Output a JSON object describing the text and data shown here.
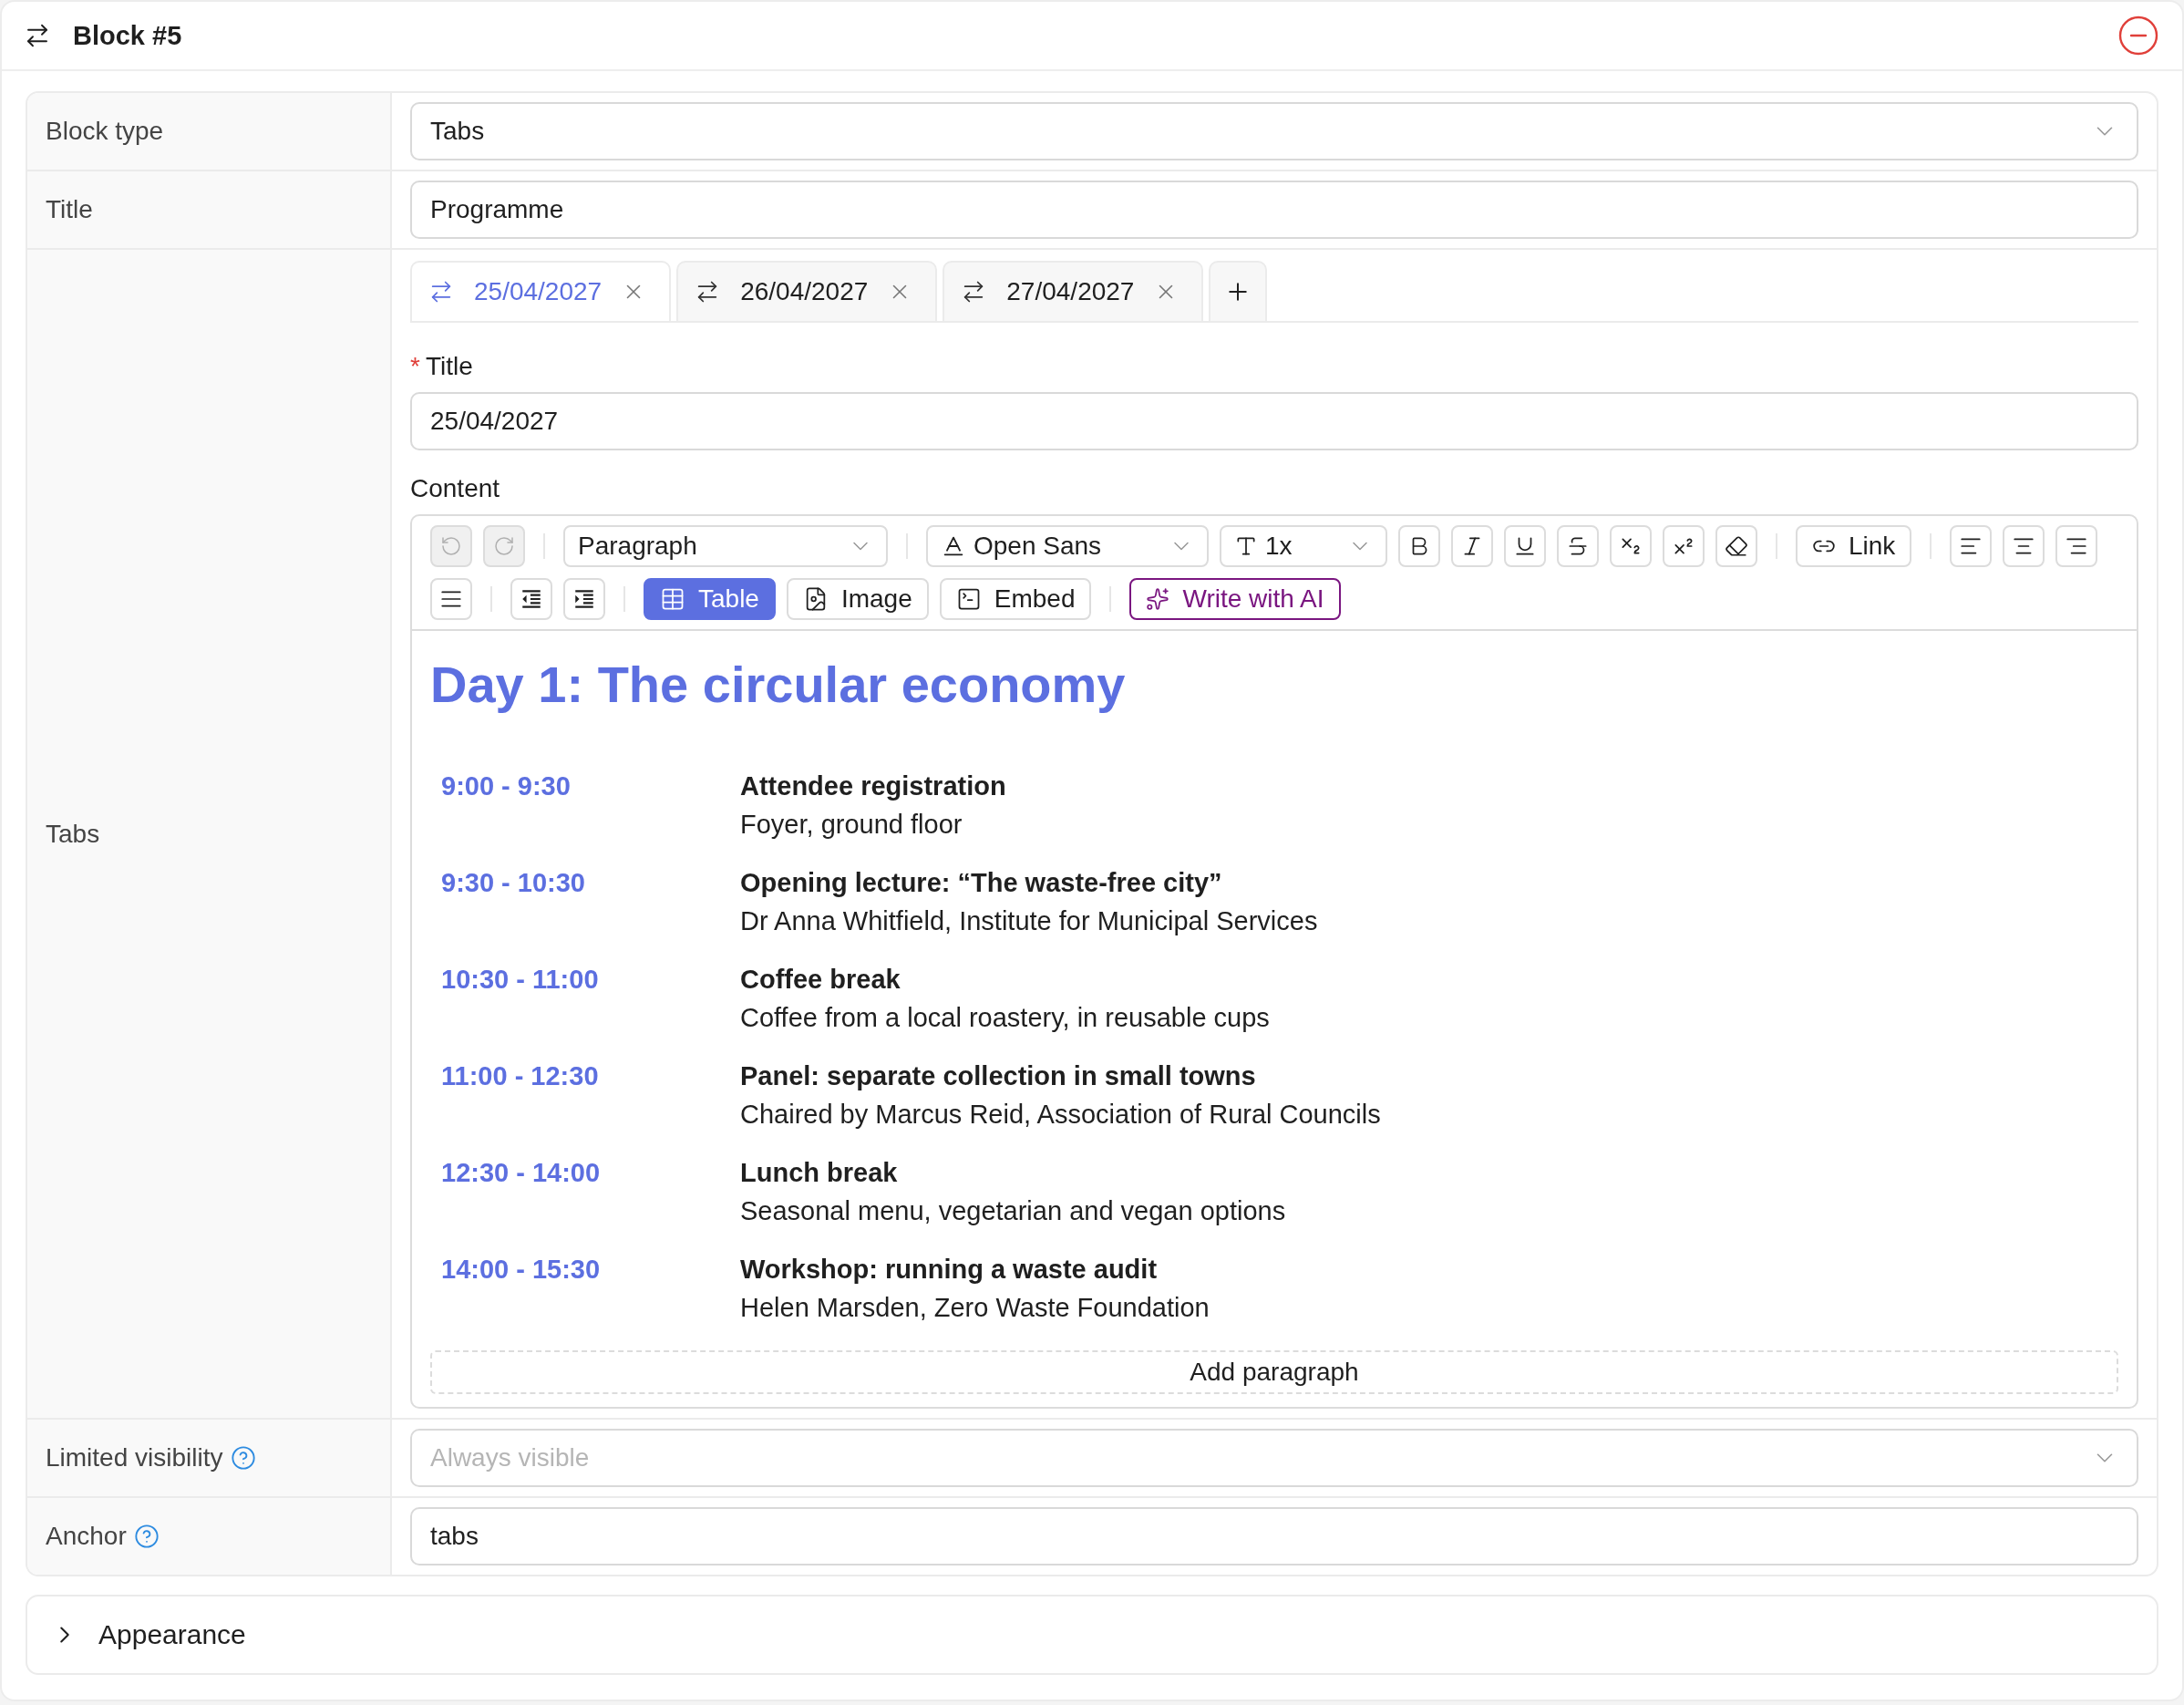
{
  "header": {
    "title": "Block #5"
  },
  "fields": [
    {
      "kind": "select",
      "label": "Block type",
      "value": "Tabs"
    },
    {
      "kind": "text",
      "label": "Title",
      "value": "Programme"
    },
    {
      "kind": "tabs",
      "label": "Tabs"
    },
    {
      "kind": "select",
      "label": "Limited visibility",
      "help": true,
      "placeholder": "Always visible"
    },
    {
      "kind": "text",
      "label": "Anchor",
      "help": true,
      "value": "tabs"
    }
  ],
  "tabs": [
    {
      "label": "25/04/2027",
      "selected": true
    },
    {
      "label": "26/04/2027",
      "selected": false
    },
    {
      "label": "27/04/2027",
      "selected": false
    }
  ],
  "tab_title": {
    "required_mark": "*",
    "label": "Title",
    "value": "25/04/2027"
  },
  "content": {
    "label": "Content",
    "toolbar": {
      "undo": {
        "disabled": true
      },
      "redo": {
        "disabled": true
      },
      "block_style": "Paragraph",
      "font": "Open Sans",
      "size": "1x",
      "link": "Link",
      "inserts": [
        {
          "kind": "table",
          "label": "Table",
          "selected": true
        },
        {
          "kind": "image",
          "label": "Image",
          "selected": false
        },
        {
          "kind": "embed",
          "label": "Embed",
          "selected": false
        }
      ],
      "ai": "Write with AI"
    },
    "heading": "Day 1: The circular economy",
    "schedule": [
      {
        "time": "9:00 - 9:30",
        "title": "Attendee registration",
        "detail": "Foyer, ground floor"
      },
      {
        "time": "9:30 - 10:30",
        "title": "Opening lecture: “The waste-free city”",
        "detail": "Dr Anna Whitfield, Institute for Municipal Services"
      },
      {
        "time": "10:30 - 11:00",
        "title": "Coffee break",
        "detail": "Coffee from a local roastery, in reusable cups"
      },
      {
        "time": "11:00 - 12:30",
        "title": "Panel: separate collection in small towns",
        "detail": "Chaired by Marcus Reid, Association of Rural Councils"
      },
      {
        "time": "12:30 - 14:00",
        "title": "Lunch break",
        "detail": "Seasonal menu, vegetarian and vegan options"
      },
      {
        "time": "14:00 - 15:30",
        "title": "Workshop: running a waste audit",
        "detail": "Helen Marsden, Zero Waste Foundation"
      }
    ],
    "add_paragraph": "Add paragraph"
  },
  "appearance": {
    "label": "Appearance",
    "expanded": false
  }
}
